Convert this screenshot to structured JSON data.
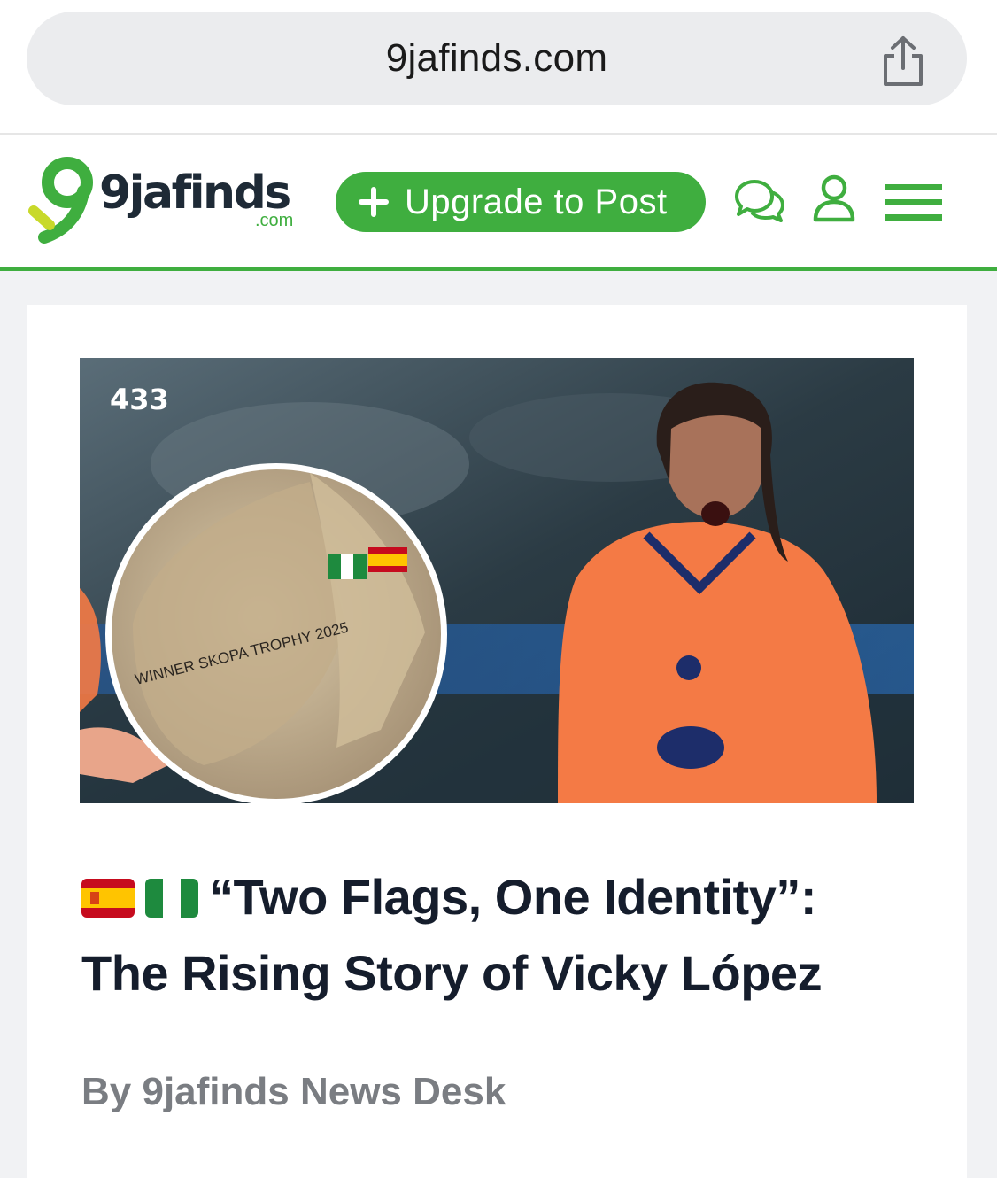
{
  "browser": {
    "url": "9jafinds.com"
  },
  "header": {
    "logo_text": "9jafinds",
    "logo_suffix": ".com",
    "upgrade_label": "Upgrade to Post"
  },
  "hero": {
    "watermark": "433",
    "boot_text": "WINNER SKOPA TROPHY 2025"
  },
  "article": {
    "title_line1": "“Two Flags, One Identity”:",
    "title_line2": "The Rising Story of Vicky López",
    "byline": "By 9jafinds News Desk"
  },
  "colors": {
    "brand_green": "#3fae3f",
    "headline": "#151d2c",
    "byline": "#7a7d82"
  }
}
